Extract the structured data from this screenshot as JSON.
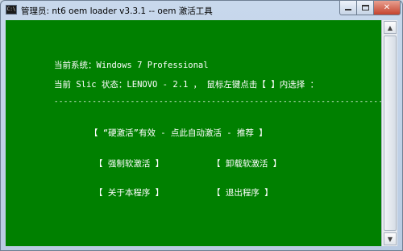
{
  "window": {
    "icon_text": "C:\\",
    "title": "管理员:  nt6 oem loader v3.3.1  -- oem 激活工具",
    "controls": {
      "minimize": "–",
      "maximize": "□",
      "close": "✕"
    }
  },
  "console": {
    "current_system": "当前系统：Windows 7 Professional",
    "slic_status": "当前 Slic 状态：LENOVO - 2.1 ， 鼠标左键点击【 】内选择 ：",
    "separator": "----------------------------------------------------------------------",
    "menu": {
      "hard_activate": "【   “硬激活”有效 - 点此自动激活 - 推荐   】",
      "force_soft_activate": "【    强制软激活    】",
      "uninstall_soft_activate": "【    卸载软激活    】",
      "about": "【    关于本程序    】",
      "exit": "【    退出程序    】"
    }
  },
  "scrollbar": {
    "up": "▲",
    "down": "▼"
  },
  "colors": {
    "console_bg": "#008000",
    "console_text": "#ffffff"
  }
}
